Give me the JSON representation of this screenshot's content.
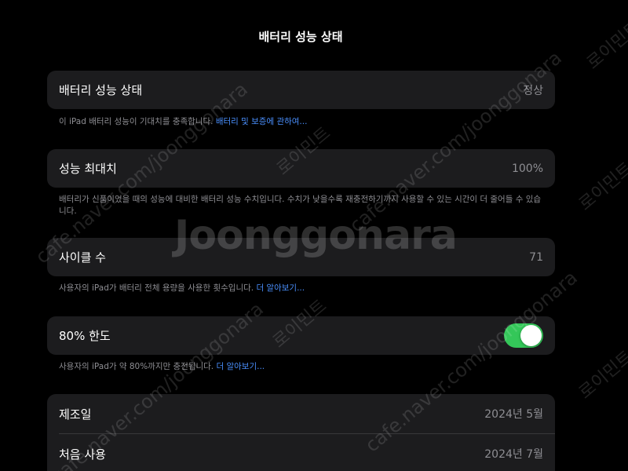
{
  "header": {
    "title": "배터리 성능 상태"
  },
  "battery_health": {
    "label": "배터리 성능 상태",
    "value": "정상",
    "footnote_text": "이 iPad 배터리 성능이 기대치를 충족합니다. ",
    "footnote_link": "배터리 및 보증에 관하여..."
  },
  "max_capacity": {
    "label": "성능 최대치",
    "value": "100%",
    "footnote_text": "배터리가 신품이었을 때의 성능에 대비한 배터리 성능 수치입니다. 수치가 낮을수록 재충전하기까지 사용할 수 있는 시간이 더 줄어들 수 있습니다."
  },
  "cycle_count": {
    "label": "사이클 수",
    "value": "71",
    "footnote_text": "사용자의 iPad가 배터리 전체 용량을 사용한 횟수입니다. ",
    "footnote_link": "더 알아보기..."
  },
  "limit_80": {
    "label": "80% 한도",
    "enabled": true,
    "footnote_text": "사용자의 iPad가 약 80%까지만 충전됩니다. ",
    "footnote_link": "더 알아보기..."
  },
  "dates": {
    "manufactured_label": "제조일",
    "manufactured_value": "2024년 5월",
    "first_use_label": "처음 사용",
    "first_use_value": "2024년 7월"
  },
  "watermark": {
    "logo": "Joonggonara",
    "url": "cafe.naver.com/joonggonara",
    "tag": "로이민트"
  },
  "colors": {
    "background": "#000000",
    "card": "#1c1c1e",
    "link": "#4a90ff",
    "toggle_on": "#34c759",
    "secondary_text": "#8e8e93"
  }
}
